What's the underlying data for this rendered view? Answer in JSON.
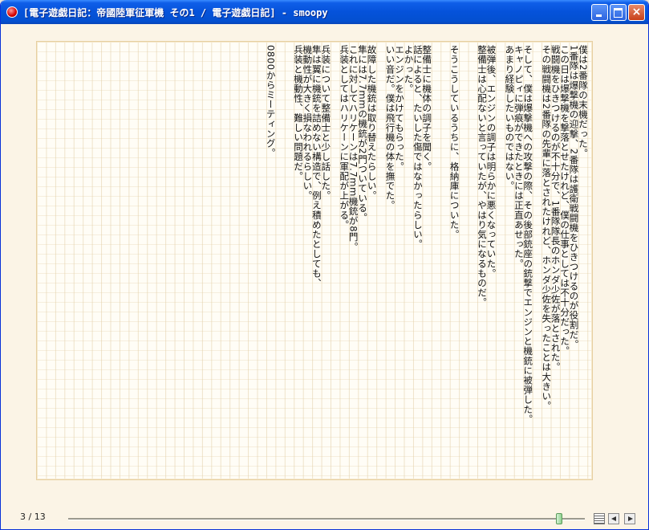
{
  "window": {
    "title": "[電子遊戯日記：帝國陸軍征軍機 その1 / 電子遊戯日記] - smoopy",
    "controls": {
      "minimize": "minimize",
      "maximize": "maximize",
      "close": "×"
    }
  },
  "content": {
    "lines": [
      "僕は2番隊の末機だった。",
      "1番隊は爆撃機の迎撃、2番隊は護衛戦闘機をひきつけるのが役割だ。",
      "この日は爆撃機を撃落とせたけれど、僕の仕事としては不十分だった。",
      "戦闘機をひきつけるのが不十分で、1番隊隊長のホンダ少佐が落とされた。",
      "その戦闘機は2番隊の先輩に落とされたけれど、ホンダ少佐を失ったことは大きい。",
      "",
      "そして、僕は爆撃機への攻撃の際、その後部銃座の銃撃でエンジンと機銃に被弾した。",
      "キャノピィに弾痕ができたときには正直あせった。",
      "あまり経験したいものではない。",
      "",
      "被弾後、エンジンの調子は明らかに悪くなっていた。",
      "整備士は心配ないと言っていたが、やはり気になるものだ。",
      "",
      "",
      "そうこうしているうちに、格納庫についた。",
      "",
      "",
      "整備士に機体の調子を聞く。",
      "話によると、たいした傷ではなかったらしい。",
      "よかった。",
      "エンジンをかけてもらった。",
      "いい音だ。僕は飛行機の体を撫でた。",
      "",
      "故障した機銃は取り替えたらしい。",
      "隼には7.7mmの機銃が2門ついている。",
      "これに対してハリケーンは7.7mm機銃が8門。",
      "兵装としてはハリケーンに軍配が上がる。",
      "",
      "兵装について整備士と少し話した。",
      "隼は翼に機銃を詰めない構造で、例え積めたとしても、",
      "機動性が大きく損なわれるらしい。",
      "兵装と機動性、難しい問題だ。",
      "",
      "",
      "0800からミーティング。"
    ]
  },
  "footer": {
    "page_indicator": "3 / 13",
    "progress": 0.95
  }
}
